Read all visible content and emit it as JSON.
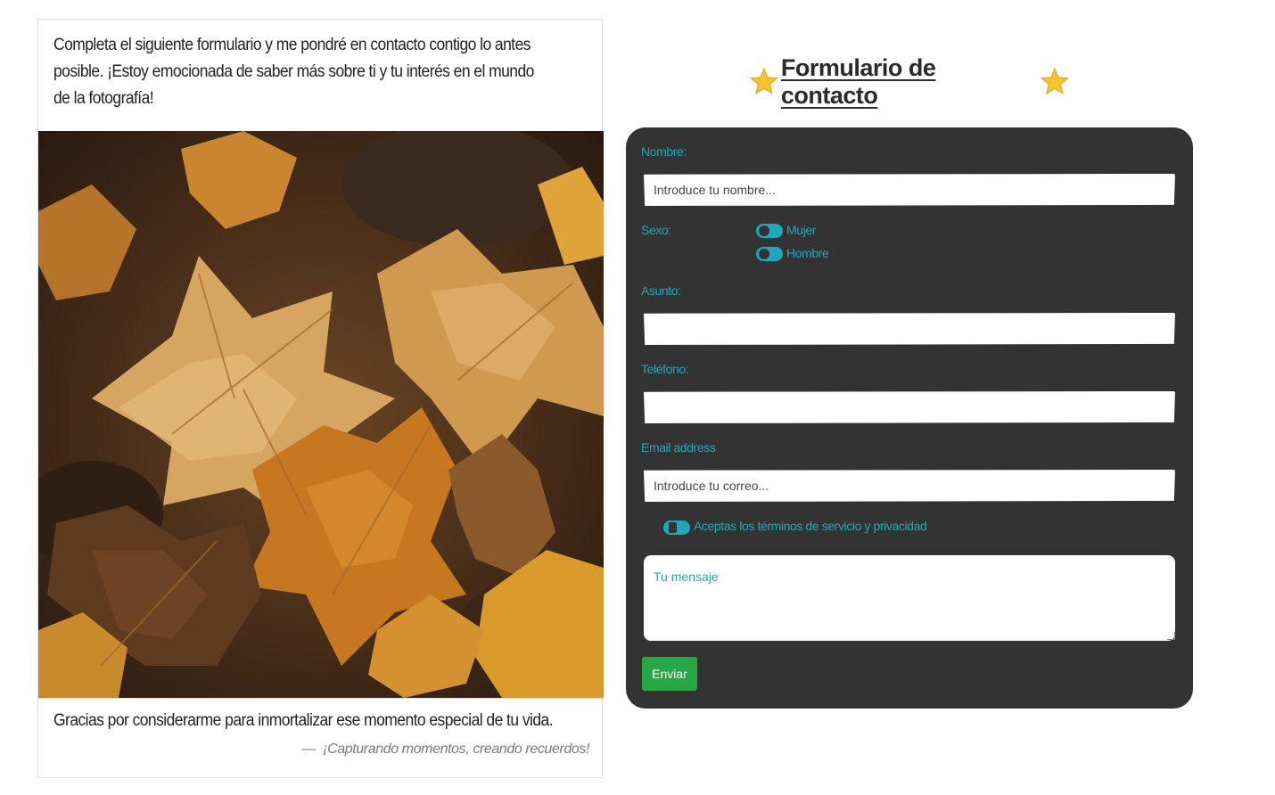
{
  "card": {
    "intro": "Completa el siguiente formulario y me pondré en contacto contigo lo antes posible. ¡Estoy emocionada de saber más sobre ti y tu interés en el mundo de la fotografía!",
    "image_icon": "autumn-leaves-photo",
    "thanks": "Gracias por considerarme para inmortalizar ese momento especial de tu vida.",
    "quote_dash": "—",
    "quote": "¡Capturando momentos, creando recuerdos!"
  },
  "form": {
    "title": "Formulario de contacto",
    "title_icon": "star-icon",
    "name_label": "Nombre:",
    "name_placeholder": "Introduce tu nombre...",
    "sex_label": "Sexo:",
    "sex_options": [
      "Mujer",
      "Hombre"
    ],
    "subject_label": "Asunto:",
    "phone_label": "Teléfono:",
    "email_label": "Email address",
    "email_placeholder": "Introduce tu correo...",
    "terms_label": "Aceptas los términos de servicio y privacidad",
    "message_placeholder": "Tu mensaje",
    "submit_label": "Enviar"
  },
  "colors": {
    "panel": "#333333",
    "accent": "#20a6bd",
    "submit": "#28a745"
  }
}
